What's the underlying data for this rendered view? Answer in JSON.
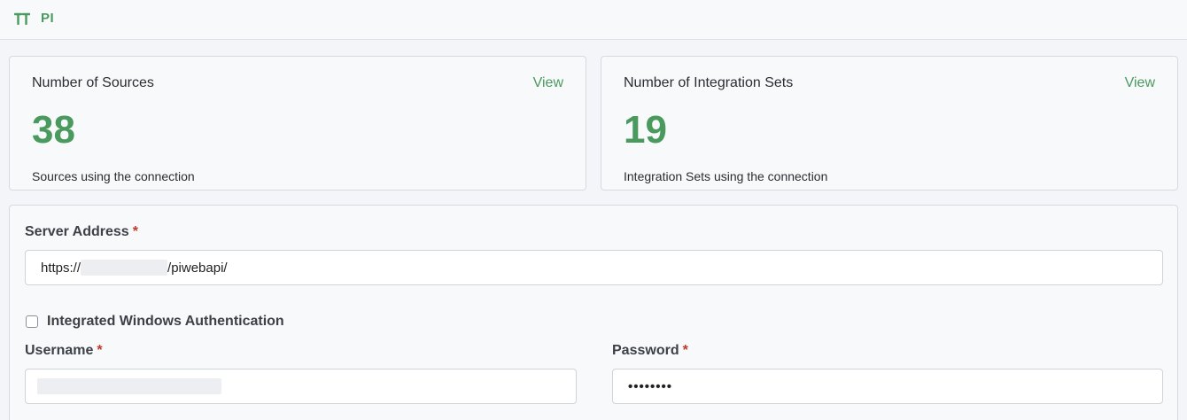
{
  "header": {
    "logo_icon": "tt-logo-icon",
    "logo_text": "PI",
    "accent_color": "#4a9a5f"
  },
  "stats": [
    {
      "title": "Number of Sources",
      "link": "View",
      "value": "38",
      "subtitle": "Sources using the connection"
    },
    {
      "title": "Number of Integration Sets",
      "link": "View",
      "value": "19",
      "subtitle": "Integration Sets using the connection"
    }
  ],
  "form": {
    "server_address_label": "Server Address",
    "required_marker": "*",
    "server_address_prefix": "https://",
    "server_address_suffix": "/piwebapi/",
    "windows_auth_label": "Integrated Windows Authentication",
    "windows_auth_checked": false,
    "username_label": "Username",
    "password_label": "Password",
    "password_value": "••••••••"
  }
}
